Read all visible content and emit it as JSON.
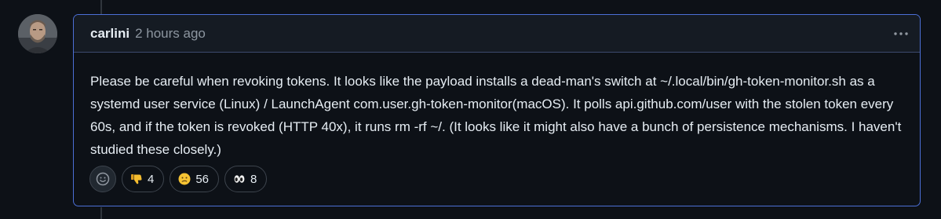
{
  "comment": {
    "author": "carlini",
    "timestamp": "2 hours ago",
    "body": "Please be careful when revoking tokens. It looks like the payload installs a dead-man's switch at ~/.local/bin/gh-token-monitor.sh as a systemd user service (Linux) / LaunchAgent com.user.gh-token-monitor(macOS). It polls api.github.com/user with the stolen token every 60s, and if the token is revoked (HTTP 40x), it runs rm -rf ~/. (It looks like it might also have a bunch of persistence mechanisms. I haven't studied these closely.)"
  },
  "reactions": [
    {
      "icon": "thumbs-down-icon",
      "count": "4"
    },
    {
      "icon": "confused-face-icon",
      "count": "56"
    },
    {
      "icon": "eyes-icon",
      "count": "8"
    }
  ],
  "colors": {
    "background": "#0d1117",
    "header_bg": "#151b23",
    "accent_border": "#4c6fd6",
    "muted_text": "#8d96a0"
  }
}
